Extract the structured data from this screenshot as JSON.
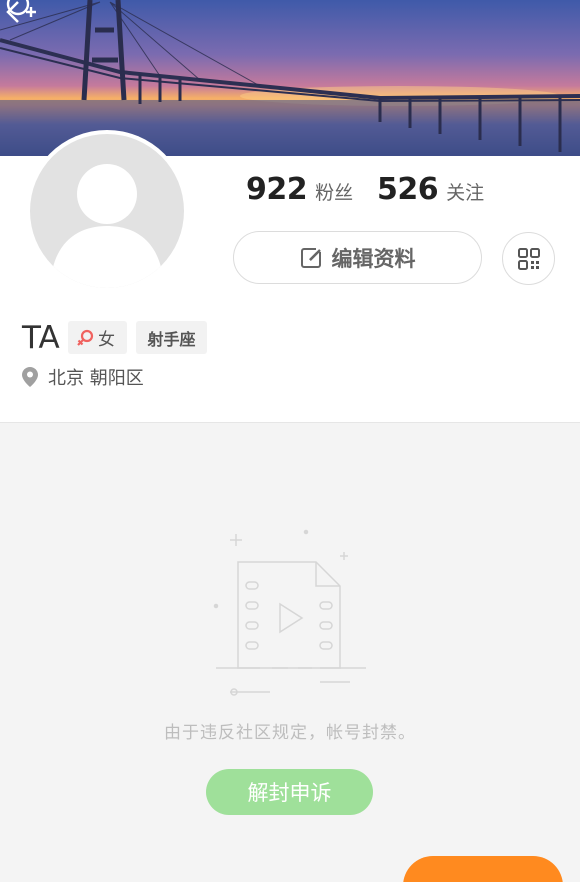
{
  "header": {
    "back_icon": "chevron-left-icon",
    "add_user_icon": "add-user-icon"
  },
  "stats": {
    "fans_count": "922",
    "fans_label": "粉丝",
    "follow_count": "526",
    "follow_label": "关注"
  },
  "actions": {
    "edit_profile_label": "编辑资料",
    "edit_icon": "edit-icon",
    "qr_icon": "qr-code-icon"
  },
  "profile": {
    "nickname": "TA",
    "gender_label": "女",
    "gender_icon": "female-icon",
    "zodiac_label": "射手座",
    "location": "北京 朝阳区",
    "location_icon": "location-pin-icon"
  },
  "empty_state": {
    "message": "由于违反社区规定，帐号封禁。",
    "appeal_label": "解封申诉",
    "illustration": "video-file-icon"
  },
  "colors": {
    "appeal_button": "#9fe09a",
    "floating_button": "#ff8a1f",
    "gender_icon": "#f0625f"
  }
}
